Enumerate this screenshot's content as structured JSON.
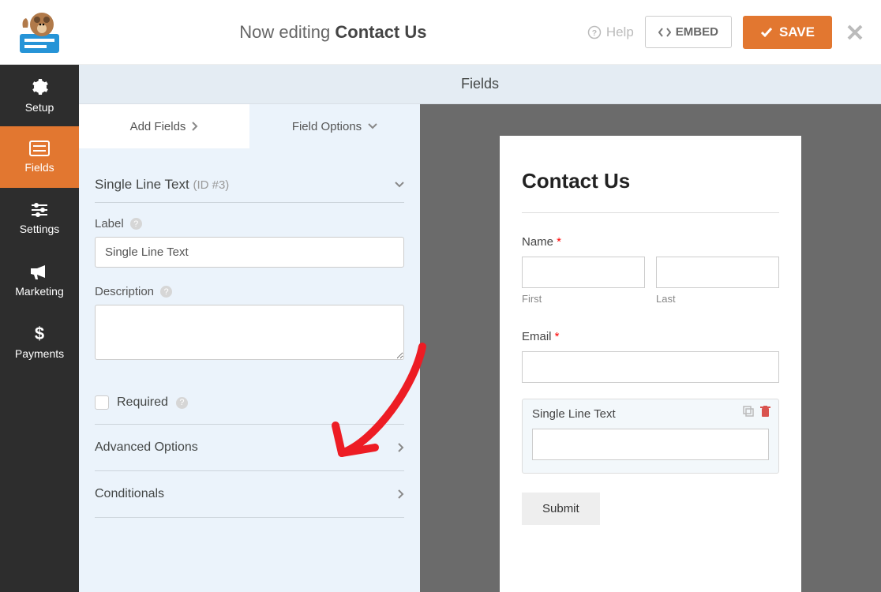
{
  "topbar": {
    "editing_prefix": "Now editing ",
    "form_name": "Contact Us",
    "help_label": "Help",
    "embed_label": "EMBED",
    "save_label": "SAVE"
  },
  "sidebar": {
    "items": [
      {
        "label": "Setup",
        "icon": "gear-icon"
      },
      {
        "label": "Fields",
        "icon": "list-icon"
      },
      {
        "label": "Settings",
        "icon": "sliders-icon"
      },
      {
        "label": "Marketing",
        "icon": "bullhorn-icon"
      },
      {
        "label": "Payments",
        "icon": "dollar-icon"
      }
    ],
    "active_index": 1
  },
  "main": {
    "title": "Fields",
    "tabs": {
      "add_fields_label": "Add Fields",
      "field_options_label": "Field Options",
      "active": "field_options"
    }
  },
  "field_options": {
    "field_type": "Single Line Text",
    "field_id": "(ID #3)",
    "label_label": "Label",
    "label_value": "Single Line Text",
    "description_label": "Description",
    "description_value": "",
    "required_label": "Required",
    "required_checked": false,
    "sections": {
      "advanced": "Advanced Options",
      "conditionals": "Conditionals"
    }
  },
  "preview": {
    "title": "Contact Us",
    "name_label": "Name",
    "first_label": "First",
    "last_label": "Last",
    "email_label": "Email",
    "single_line_label": "Single Line Text",
    "submit_label": "Submit"
  }
}
